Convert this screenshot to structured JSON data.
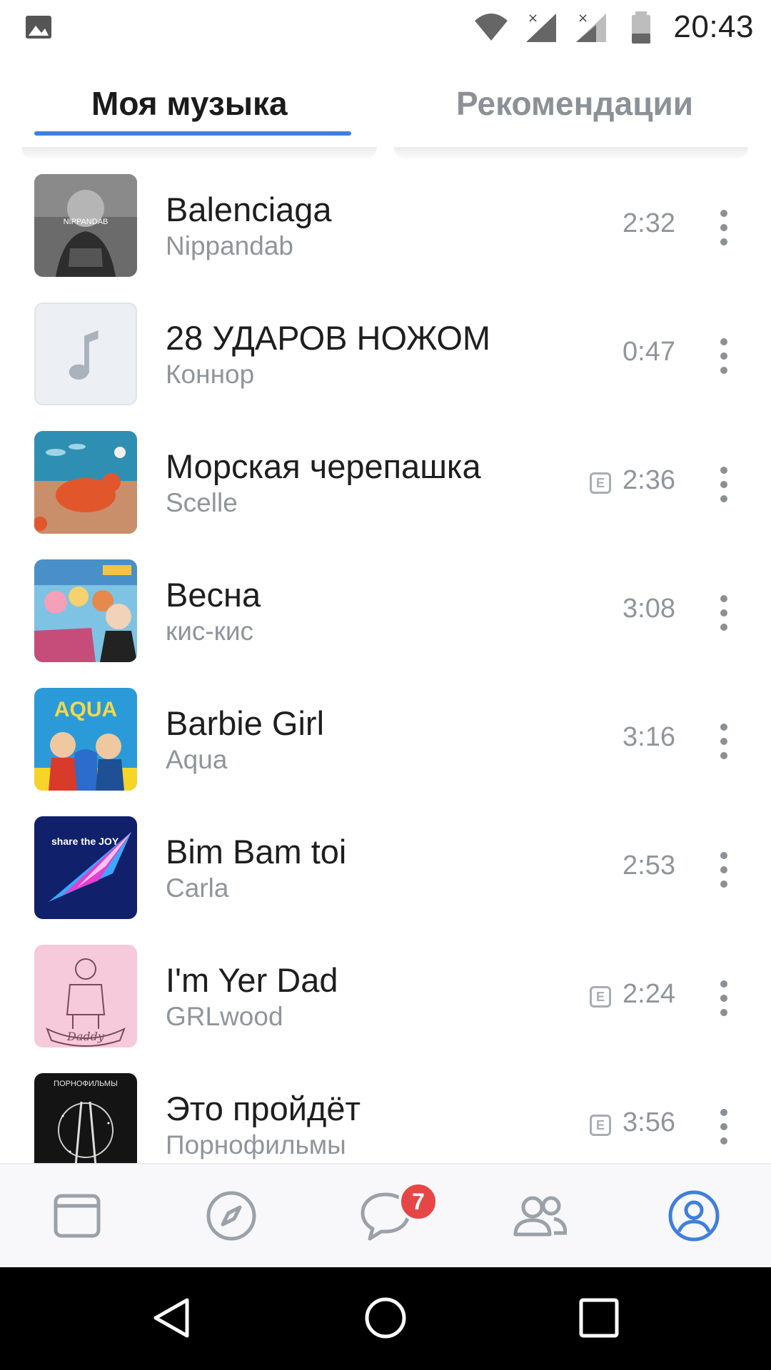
{
  "status_bar": {
    "time": "20:43"
  },
  "tabs": [
    {
      "label": "Моя музыка",
      "active": true
    },
    {
      "label": "Рекомендации",
      "active": false
    }
  ],
  "accent_color": "#3f7fdc",
  "tracks": [
    {
      "title": "Balenciaga",
      "artist": "Nippandab",
      "duration": "2:32",
      "explicit": false,
      "cover_text": "NIPPANDAB"
    },
    {
      "title": "28 УДАРОВ НОЖОМ",
      "artist": "Коннор",
      "duration": "0:47",
      "explicit": false,
      "cover": "placeholder-note-icon"
    },
    {
      "title": "Морская черепашка",
      "artist": "Scelle",
      "duration": "2:36",
      "explicit": true
    },
    {
      "title": "Весна",
      "artist": "кис-кис",
      "duration": "3:08",
      "explicit": false
    },
    {
      "title": "Barbie Girl",
      "artist": "Aqua",
      "duration": "3:16",
      "explicit": false,
      "cover_text": "AQUA"
    },
    {
      "title": "Bim Bam toi",
      "artist": "Carla",
      "duration": "2:53",
      "explicit": false,
      "cover_text": "share the JOY"
    },
    {
      "title": "I'm Yer Dad",
      "artist": "GRLwood",
      "duration": "2:24",
      "explicit": true,
      "cover_text": "Daddy"
    },
    {
      "title": "Это пройдёт",
      "artist": "Порнофильмы",
      "duration": "3:56",
      "explicit": true,
      "cover_text": "ПОРНОФИЛЬМЫ"
    }
  ],
  "explicit_mark": "E",
  "bottom_nav": {
    "items": [
      "news-icon",
      "explore-icon",
      "messages-icon",
      "friends-icon",
      "profile-icon"
    ],
    "messages_badge": "7",
    "active": "profile-icon"
  }
}
